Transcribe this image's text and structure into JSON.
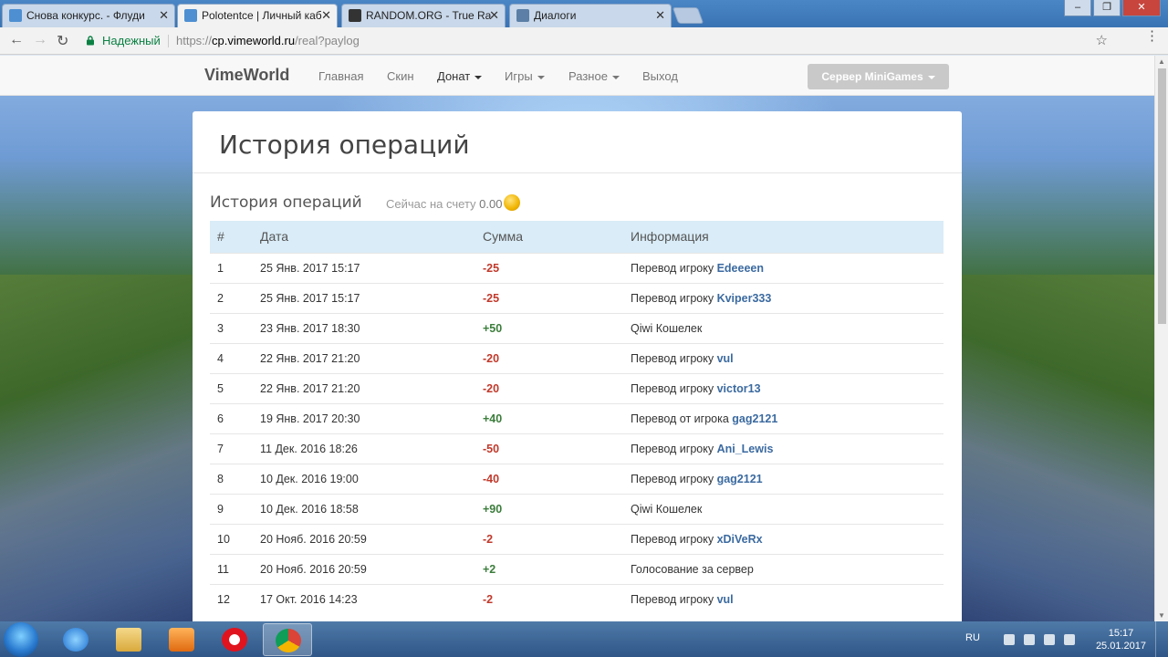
{
  "browser": {
    "tabs": [
      {
        "title": "Снова конкурс. - Флуди",
        "icon": "vimeworld-icon",
        "active": false
      },
      {
        "title": "Polotentce | Личный каб",
        "icon": "vimeworld-icon",
        "active": true
      },
      {
        "title": "RANDOM.ORG - True Ra",
        "icon": "random-org-icon",
        "active": false
      },
      {
        "title": "Диалоги",
        "icon": "vk-icon",
        "active": false
      }
    ],
    "close_glyph": "✕",
    "secure_label": "Надежный",
    "url_scheme": "https://",
    "url_host": "cp.vimeworld.ru",
    "url_path": "/real?paylog"
  },
  "site_nav": {
    "brand": "VimeWorld",
    "links": {
      "home": "Главная",
      "skin": "Скин",
      "donate": "Донат",
      "games": "Игры",
      "misc": "Разное",
      "logout": "Выход"
    },
    "server_button": "Сервер MiniGames"
  },
  "panel": {
    "title": "История операций",
    "subtitle": "История операций",
    "balance_label": "Сейчас на счету",
    "balance_value": "0.00"
  },
  "table": {
    "headers": [
      "#",
      "Дата",
      "Сумма",
      "Информация"
    ],
    "rows": [
      {
        "n": "1",
        "date": "25 Янв. 2017 15:17",
        "amount": "-25",
        "sign": "neg",
        "info": "Перевод игроку",
        "player": "Edeeeen"
      },
      {
        "n": "2",
        "date": "25 Янв. 2017 15:17",
        "amount": "-25",
        "sign": "neg",
        "info": "Перевод игроку",
        "player": "Kviper333"
      },
      {
        "n": "3",
        "date": "23 Янв. 2017 18:30",
        "amount": "+50",
        "sign": "pos",
        "info": "Qiwi Кошелек",
        "player": ""
      },
      {
        "n": "4",
        "date": "22 Янв. 2017 21:20",
        "amount": "-20",
        "sign": "neg",
        "info": "Перевод игроку",
        "player": "vul"
      },
      {
        "n": "5",
        "date": "22 Янв. 2017 21:20",
        "amount": "-20",
        "sign": "neg",
        "info": "Перевод игроку",
        "player": "victor13"
      },
      {
        "n": "6",
        "date": "19 Янв. 2017 20:30",
        "amount": "+40",
        "sign": "pos",
        "info": "Перевод от игрока",
        "player": "gag2121"
      },
      {
        "n": "7",
        "date": "11 Дек. 2016 18:26",
        "amount": "-50",
        "sign": "neg",
        "info": "Перевод игроку",
        "player": "Ani_Lewis"
      },
      {
        "n": "8",
        "date": "10 Дек. 2016 19:00",
        "amount": "-40",
        "sign": "neg",
        "info": "Перевод игроку",
        "player": "gag2121"
      },
      {
        "n": "9",
        "date": "10 Дек. 2016 18:58",
        "amount": "+90",
        "sign": "pos",
        "info": "Qiwi Кошелек",
        "player": ""
      },
      {
        "n": "10",
        "date": "20 Нояб. 2016 20:59",
        "amount": "-2",
        "sign": "neg",
        "info": "Перевод игроку",
        "player": "xDiVeRx"
      },
      {
        "n": "11",
        "date": "20 Нояб. 2016 20:59",
        "amount": "+2",
        "sign": "pos",
        "info": "Голосование за сервер",
        "player": ""
      },
      {
        "n": "12",
        "date": "17 Окт. 2016 14:23",
        "amount": "-2",
        "sign": "neg",
        "info": "Перевод игроку",
        "player": "vul"
      }
    ]
  },
  "taskbar": {
    "apps": [
      "internet-explorer-icon",
      "file-explorer-icon",
      "media-player-icon",
      "opera-icon",
      "chrome-icon"
    ],
    "active_app": "chrome-icon",
    "language": "RU",
    "time": "15:17",
    "date": "25.01.2017"
  },
  "colors": {
    "negative": "#c0392b",
    "positive": "#3c7d3c",
    "table_header": "#d9ecf7",
    "player_link": "#3b6aa0"
  }
}
